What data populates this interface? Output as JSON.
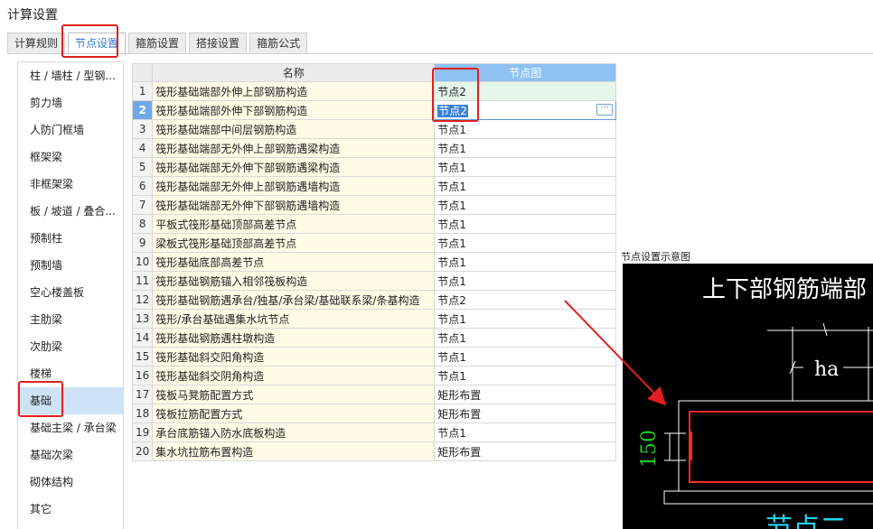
{
  "window": {
    "title": "计算设置"
  },
  "tabs": [
    {
      "label": "计算规则"
    },
    {
      "label": "节点设置"
    },
    {
      "label": "箍筋设置"
    },
    {
      "label": "搭接设置"
    },
    {
      "label": "箍筋公式"
    }
  ],
  "sidebar": {
    "items": [
      {
        "label": "柱 / 墙柱 / 型钢..."
      },
      {
        "label": "剪力墙"
      },
      {
        "label": "人防门框墙"
      },
      {
        "label": "框架梁"
      },
      {
        "label": "非框架梁"
      },
      {
        "label": "板 / 坡道 / 叠合..."
      },
      {
        "label": "预制柱"
      },
      {
        "label": "预制墙"
      },
      {
        "label": "空心楼盖板"
      },
      {
        "label": "主肋梁"
      },
      {
        "label": "次肋梁"
      },
      {
        "label": "楼梯"
      },
      {
        "label": "基础"
      },
      {
        "label": "基础主梁 / 承台梁"
      },
      {
        "label": "基础次梁"
      },
      {
        "label": "砌体结构"
      },
      {
        "label": "其它"
      }
    ],
    "active_index": 12
  },
  "grid": {
    "headers": {
      "name": "名称",
      "node": "节点图"
    },
    "rows": [
      {
        "num": "1",
        "name": "筏形基础端部外伸上部钢筋构造",
        "value": "节点2"
      },
      {
        "num": "2",
        "name": "筏形基础端部外伸下部钢筋构造",
        "value": "节点2"
      },
      {
        "num": "3",
        "name": "筏形基础端部中间层钢筋构造",
        "value": "节点1"
      },
      {
        "num": "4",
        "name": "筏形基础端部无外伸上部钢筋遇梁构造",
        "value": "节点1"
      },
      {
        "num": "5",
        "name": "筏形基础端部无外伸下部钢筋遇梁构造",
        "value": "节点1"
      },
      {
        "num": "6",
        "name": "筏形基础端部无外伸上部钢筋遇墙构造",
        "value": "节点1"
      },
      {
        "num": "7",
        "name": "筏形基础端部无外伸下部钢筋遇墙构造",
        "value": "节点1"
      },
      {
        "num": "8",
        "name": "平板式筏形基础顶部高差节点",
        "value": "节点1"
      },
      {
        "num": "9",
        "name": "梁板式筏形基础顶部高差节点",
        "value": "节点1"
      },
      {
        "num": "10",
        "name": "筏形基础底部高差节点",
        "value": "节点1"
      },
      {
        "num": "11",
        "name": "筏形基础钢筋锚入相邻筏板构造",
        "value": "节点1"
      },
      {
        "num": "12",
        "name": "筏形基础钢筋遇承台/独基/承台梁/基础联系梁/条基构造",
        "value": "节点2"
      },
      {
        "num": "13",
        "name": "筏形/承台基础遇集水坑节点",
        "value": "节点1"
      },
      {
        "num": "14",
        "name": "筏形基础钢筋遇柱墩构造",
        "value": "节点1"
      },
      {
        "num": "15",
        "name": "筏形基础斜交阳角构造",
        "value": "节点1"
      },
      {
        "num": "16",
        "name": "筏形基础斜交阴角构造",
        "value": "节点1"
      },
      {
        "num": "17",
        "name": "筏板马凳筋配置方式",
        "value": "矩形布置"
      },
      {
        "num": "18",
        "name": "筏板拉筋配置方式",
        "value": "矩形布置"
      },
      {
        "num": "19",
        "name": "承台底筋锚入防水底板构造",
        "value": "节点1"
      },
      {
        "num": "20",
        "name": "集水坑拉筋布置构造",
        "value": "矩形布置"
      }
    ],
    "active_row": 1,
    "edit_button_label": "···"
  },
  "preview": {
    "title": "节点设置示意图",
    "heading": "上下部钢筋端部",
    "dim_ha": "ha",
    "dim_150": "150",
    "bottom_label": "节点二"
  },
  "colors": {
    "annotation_red": "#e02020",
    "accent_blue": "#3a7bd5",
    "header_blue": "#8ec2f3",
    "name_cell_bg": "#fffbe6",
    "drawing_bg": "#000000",
    "dim_green": "#22cc22",
    "label_cyan": "#22d3ee"
  },
  "icons": {
    "edit_button": "ellipsis-icon",
    "annotation_arrow": "red-arrow-icon"
  }
}
